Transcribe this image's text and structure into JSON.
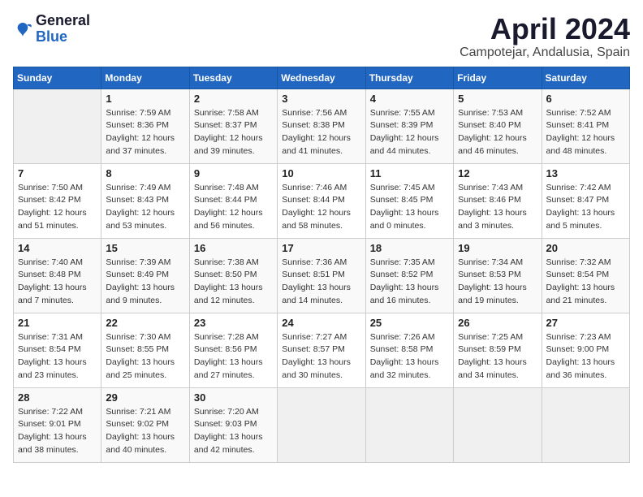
{
  "logo": {
    "general": "General",
    "blue": "Blue"
  },
  "title": "April 2024",
  "location": "Campotejar, Andalusia, Spain",
  "weekdays": [
    "Sunday",
    "Monday",
    "Tuesday",
    "Wednesday",
    "Thursday",
    "Friday",
    "Saturday"
  ],
  "weeks": [
    [
      {
        "day": "",
        "info": ""
      },
      {
        "day": "1",
        "info": "Sunrise: 7:59 AM\nSunset: 8:36 PM\nDaylight: 12 hours\nand 37 minutes."
      },
      {
        "day": "2",
        "info": "Sunrise: 7:58 AM\nSunset: 8:37 PM\nDaylight: 12 hours\nand 39 minutes."
      },
      {
        "day": "3",
        "info": "Sunrise: 7:56 AM\nSunset: 8:38 PM\nDaylight: 12 hours\nand 41 minutes."
      },
      {
        "day": "4",
        "info": "Sunrise: 7:55 AM\nSunset: 8:39 PM\nDaylight: 12 hours\nand 44 minutes."
      },
      {
        "day": "5",
        "info": "Sunrise: 7:53 AM\nSunset: 8:40 PM\nDaylight: 12 hours\nand 46 minutes."
      },
      {
        "day": "6",
        "info": "Sunrise: 7:52 AM\nSunset: 8:41 PM\nDaylight: 12 hours\nand 48 minutes."
      }
    ],
    [
      {
        "day": "7",
        "info": "Sunrise: 7:50 AM\nSunset: 8:42 PM\nDaylight: 12 hours\nand 51 minutes."
      },
      {
        "day": "8",
        "info": "Sunrise: 7:49 AM\nSunset: 8:43 PM\nDaylight: 12 hours\nand 53 minutes."
      },
      {
        "day": "9",
        "info": "Sunrise: 7:48 AM\nSunset: 8:44 PM\nDaylight: 12 hours\nand 56 minutes."
      },
      {
        "day": "10",
        "info": "Sunrise: 7:46 AM\nSunset: 8:44 PM\nDaylight: 12 hours\nand 58 minutes."
      },
      {
        "day": "11",
        "info": "Sunrise: 7:45 AM\nSunset: 8:45 PM\nDaylight: 13 hours\nand 0 minutes."
      },
      {
        "day": "12",
        "info": "Sunrise: 7:43 AM\nSunset: 8:46 PM\nDaylight: 13 hours\nand 3 minutes."
      },
      {
        "day": "13",
        "info": "Sunrise: 7:42 AM\nSunset: 8:47 PM\nDaylight: 13 hours\nand 5 minutes."
      }
    ],
    [
      {
        "day": "14",
        "info": "Sunrise: 7:40 AM\nSunset: 8:48 PM\nDaylight: 13 hours\nand 7 minutes."
      },
      {
        "day": "15",
        "info": "Sunrise: 7:39 AM\nSunset: 8:49 PM\nDaylight: 13 hours\nand 9 minutes."
      },
      {
        "day": "16",
        "info": "Sunrise: 7:38 AM\nSunset: 8:50 PM\nDaylight: 13 hours\nand 12 minutes."
      },
      {
        "day": "17",
        "info": "Sunrise: 7:36 AM\nSunset: 8:51 PM\nDaylight: 13 hours\nand 14 minutes."
      },
      {
        "day": "18",
        "info": "Sunrise: 7:35 AM\nSunset: 8:52 PM\nDaylight: 13 hours\nand 16 minutes."
      },
      {
        "day": "19",
        "info": "Sunrise: 7:34 AM\nSunset: 8:53 PM\nDaylight: 13 hours\nand 19 minutes."
      },
      {
        "day": "20",
        "info": "Sunrise: 7:32 AM\nSunset: 8:54 PM\nDaylight: 13 hours\nand 21 minutes."
      }
    ],
    [
      {
        "day": "21",
        "info": "Sunrise: 7:31 AM\nSunset: 8:54 PM\nDaylight: 13 hours\nand 23 minutes."
      },
      {
        "day": "22",
        "info": "Sunrise: 7:30 AM\nSunset: 8:55 PM\nDaylight: 13 hours\nand 25 minutes."
      },
      {
        "day": "23",
        "info": "Sunrise: 7:28 AM\nSunset: 8:56 PM\nDaylight: 13 hours\nand 27 minutes."
      },
      {
        "day": "24",
        "info": "Sunrise: 7:27 AM\nSunset: 8:57 PM\nDaylight: 13 hours\nand 30 minutes."
      },
      {
        "day": "25",
        "info": "Sunrise: 7:26 AM\nSunset: 8:58 PM\nDaylight: 13 hours\nand 32 minutes."
      },
      {
        "day": "26",
        "info": "Sunrise: 7:25 AM\nSunset: 8:59 PM\nDaylight: 13 hours\nand 34 minutes."
      },
      {
        "day": "27",
        "info": "Sunrise: 7:23 AM\nSunset: 9:00 PM\nDaylight: 13 hours\nand 36 minutes."
      }
    ],
    [
      {
        "day": "28",
        "info": "Sunrise: 7:22 AM\nSunset: 9:01 PM\nDaylight: 13 hours\nand 38 minutes."
      },
      {
        "day": "29",
        "info": "Sunrise: 7:21 AM\nSunset: 9:02 PM\nDaylight: 13 hours\nand 40 minutes."
      },
      {
        "day": "30",
        "info": "Sunrise: 7:20 AM\nSunset: 9:03 PM\nDaylight: 13 hours\nand 42 minutes."
      },
      {
        "day": "",
        "info": ""
      },
      {
        "day": "",
        "info": ""
      },
      {
        "day": "",
        "info": ""
      },
      {
        "day": "",
        "info": ""
      }
    ]
  ]
}
